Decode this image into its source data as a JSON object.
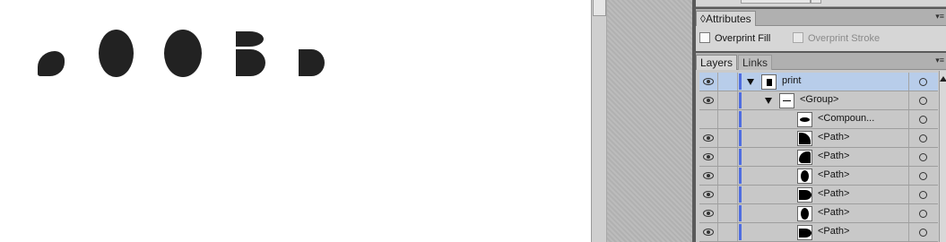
{
  "attributes_panel": {
    "tab_label": "Attributes",
    "tab_glyph": "◊",
    "overprint_fill_label": "Overprint Fill",
    "overprint_stroke_label": "Overprint Stroke",
    "overprint_fill_checked": false,
    "overprint_stroke_enabled": false
  },
  "layers_panel": {
    "tabs": [
      {
        "label": "Layers"
      },
      {
        "label": "Links"
      }
    ],
    "rows": [
      {
        "name": "print",
        "visible": true,
        "expanded": true,
        "selected": true
      },
      {
        "name": "<Group>",
        "visible": true,
        "expanded": true,
        "selected": false
      },
      {
        "name": "<Compoun...",
        "visible": false,
        "selected": false
      },
      {
        "name": "<Path>",
        "visible": true,
        "selected": false
      },
      {
        "name": "<Path>",
        "visible": true,
        "selected": false
      },
      {
        "name": "<Path>",
        "visible": true,
        "selected": false
      },
      {
        "name": "<Path>",
        "visible": true,
        "selected": false
      },
      {
        "name": "<Path>",
        "visible": true,
        "selected": false
      },
      {
        "name": "<Path>",
        "visible": true,
        "selected": false
      }
    ]
  },
  "icons": {
    "panel_menu": "panel-menu-icon",
    "visibility": "eye-icon",
    "expand": "disclosure-triangle-icon",
    "target": "target-circle-icon"
  },
  "colors": {
    "selection": "#b8cdea",
    "layer_color": "#4f6de0",
    "artwork": "#222222"
  }
}
